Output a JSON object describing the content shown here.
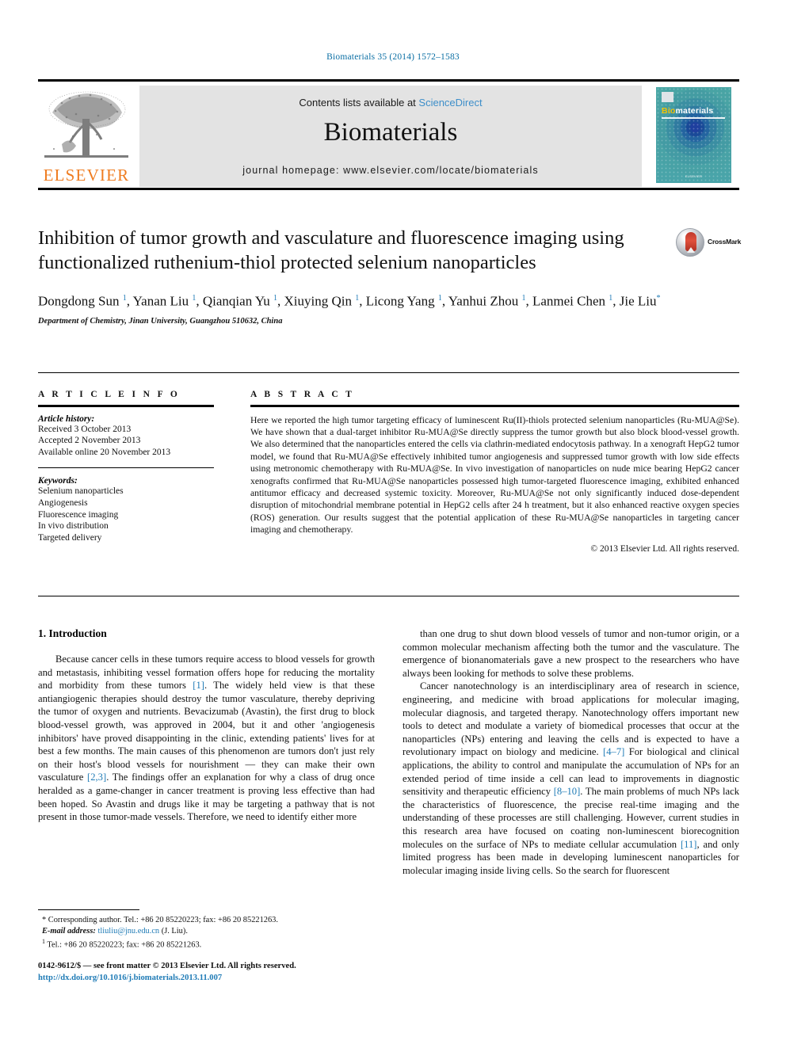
{
  "running_head": "Biomaterials 35 (2014) 1572–1583",
  "masthead": {
    "contents_prefix": "Contents lists available at ",
    "sciencedirect": "ScienceDirect",
    "journal_name": "Biomaterials",
    "homepage": "journal homepage: www.elsevier.com/locate/biomaterials",
    "publisher_wordmark": "ELSEVIER",
    "cover": {
      "title_part1": "Bio",
      "title_part2": "materials",
      "footer_text": "ELSEVIER"
    }
  },
  "article": {
    "title": "Inhibition of tumor growth and vasculature and fluorescence imaging using functionalized ruthenium-thiol protected selenium nanoparticles",
    "crossmark_label": "CrossMark",
    "authors_html": "Dongdong Sun <sup>1</sup>, Yanan Liu <sup>1</sup>, Qianqian Yu <sup>1</sup>, Xiuying Qin <sup>1</sup>, Licong Yang <sup>1</sup>, Yanhui Zhou <sup>1</sup>, Lanmei Chen <sup>1</sup>, Jie Liu<sup class=\"star\">*</sup>",
    "affiliation": "Department of Chemistry, Jinan University, Guangzhou 510632, China"
  },
  "article_info": {
    "heading": "A R T I C L E   I N F O",
    "history_label": "Article history:",
    "history": [
      "Received 3 October 2013",
      "Accepted 2 November 2013",
      "Available online 20 November 2013"
    ],
    "keywords_label": "Keywords:",
    "keywords": [
      "Selenium nanoparticles",
      "Angiogenesis",
      "Fluorescence imaging",
      "In vivo distribution",
      "Targeted delivery"
    ]
  },
  "abstract": {
    "heading": "A B S T R A C T",
    "text": "Here we reported the high tumor targeting efficacy of luminescent Ru(II)-thiols protected selenium nanoparticles (Ru-MUA@Se). We have shown that a dual-target inhibitor Ru-MUA@Se directly suppress the tumor growth but also block blood-vessel growth. We also determined that the nanoparticles entered the cells via clathrin-mediated endocytosis pathway. In a xenograft HepG2 tumor model, we found that Ru-MUA@Se effectively inhibited tumor angiogenesis and suppressed tumor growth with low side effects using metronomic chemotherapy with Ru-MUA@Se. In vivo investigation of nanoparticles on nude mice bearing HepG2 cancer xenografts confirmed that Ru-MUA@Se nanoparticles possessed high tumor-targeted fluorescence imaging, exhibited enhanced antitumor efficacy and decreased systemic toxicity. Moreover, Ru-MUA@Se not only significantly induced dose-dependent disruption of mitochondrial membrane potential in HepG2 cells after 24 h treatment, but it also enhanced reactive oxygen species (ROS) generation. Our results suggest that the potential application of these Ru-MUA@Se nanoparticles in targeting cancer imaging and chemotherapy.",
    "copyright": "© 2013 Elsevier Ltd. All rights reserved."
  },
  "body": {
    "section_title": "1.  Introduction",
    "left_paragraphs_html": [
      "Because cancer cells in these tumors require access to blood vessels for growth and metastasis, inhibiting vessel formation offers hope for reducing the mortality and morbidity from these tumors <span class=\"ref\">[1]</span>. The widely held view is that these antiangiogenic therapies should destroy the tumor vasculature, thereby depriving the tumor of oxygen and nutrients. Bevacizumab (Avastin), the first drug to block blood-vessel growth, was approved in 2004, but it and other 'angiogenesis inhibitors' have proved disappointing in the clinic, extending patients' lives for at best a few months. The main causes of this phenomenon are tumors don't just rely on their host's blood vessels for nourishment &mdash; they can make their own vasculature <span class=\"ref\">[2,3]</span>. The findings offer an explanation for why a class of drug once heralded as a game-changer in cancer treatment is proving less effective than had been hoped. So Avastin and drugs like it may be targeting a pathway that is not present in those tumor-made vessels. Therefore, we need to identify either more"
    ],
    "right_paragraphs_html": [
      "than one drug to shut down blood vessels of tumor and non-tumor origin, or a common molecular mechanism affecting both the tumor and the vasculature. The emergence of bionanomaterials gave a new prospect to the researchers who have always been looking for methods to solve these problems.",
      "Cancer nanotechnology is an interdisciplinary area of research in science, engineering, and medicine with broad applications for molecular imaging, molecular diagnosis, and targeted therapy. Nanotechnology offers important new tools to detect and modulate a variety of biomedical processes that occur at the nanoparticles (NPs) entering and leaving the cells and is expected to have a revolutionary impact on biology and medicine. <span class=\"ref\">[4&ndash;7]</span> For biological and clinical applications, the ability to control and manipulate the accumulation of NPs for an extended period of time inside a cell can lead to improvements in diagnostic sensitivity and therapeutic efficiency <span class=\"ref\">[8&ndash;10]</span>. The main problems of much NPs lack the characteristics of fluorescence, the precise real-time imaging and the understanding of these processes are still challenging. However, current studies in this research area have focused on coating non-luminescent biorecognition molecules on the surface of NPs to mediate cellular accumulation <span class=\"ref\">[11]</span>, and only limited progress has been made in developing luminescent nanoparticles for molecular imaging inside living cells. So the search for fluorescent"
    ]
  },
  "footnotes": {
    "corresponding_html": "* Corresponding author. Tel.: +86 20 85220223; fax: +86 20 85221263.",
    "email_html": "<em>E-mail address:</em> <span class=\"fn-mail\">tliuliu@jnu.edu.cn</span> (J. Liu).",
    "tel_html": "<span class=\"fn-sup\">1</span>  Tel.: +86 20 85220223; fax: +86 20 85221263."
  },
  "colophon": {
    "line1": "0142-9612/$ — see front matter © 2013 Elsevier Ltd. All rights reserved.",
    "doi": "http://dx.doi.org/10.1016/j.biomaterials.2013.11.007"
  }
}
